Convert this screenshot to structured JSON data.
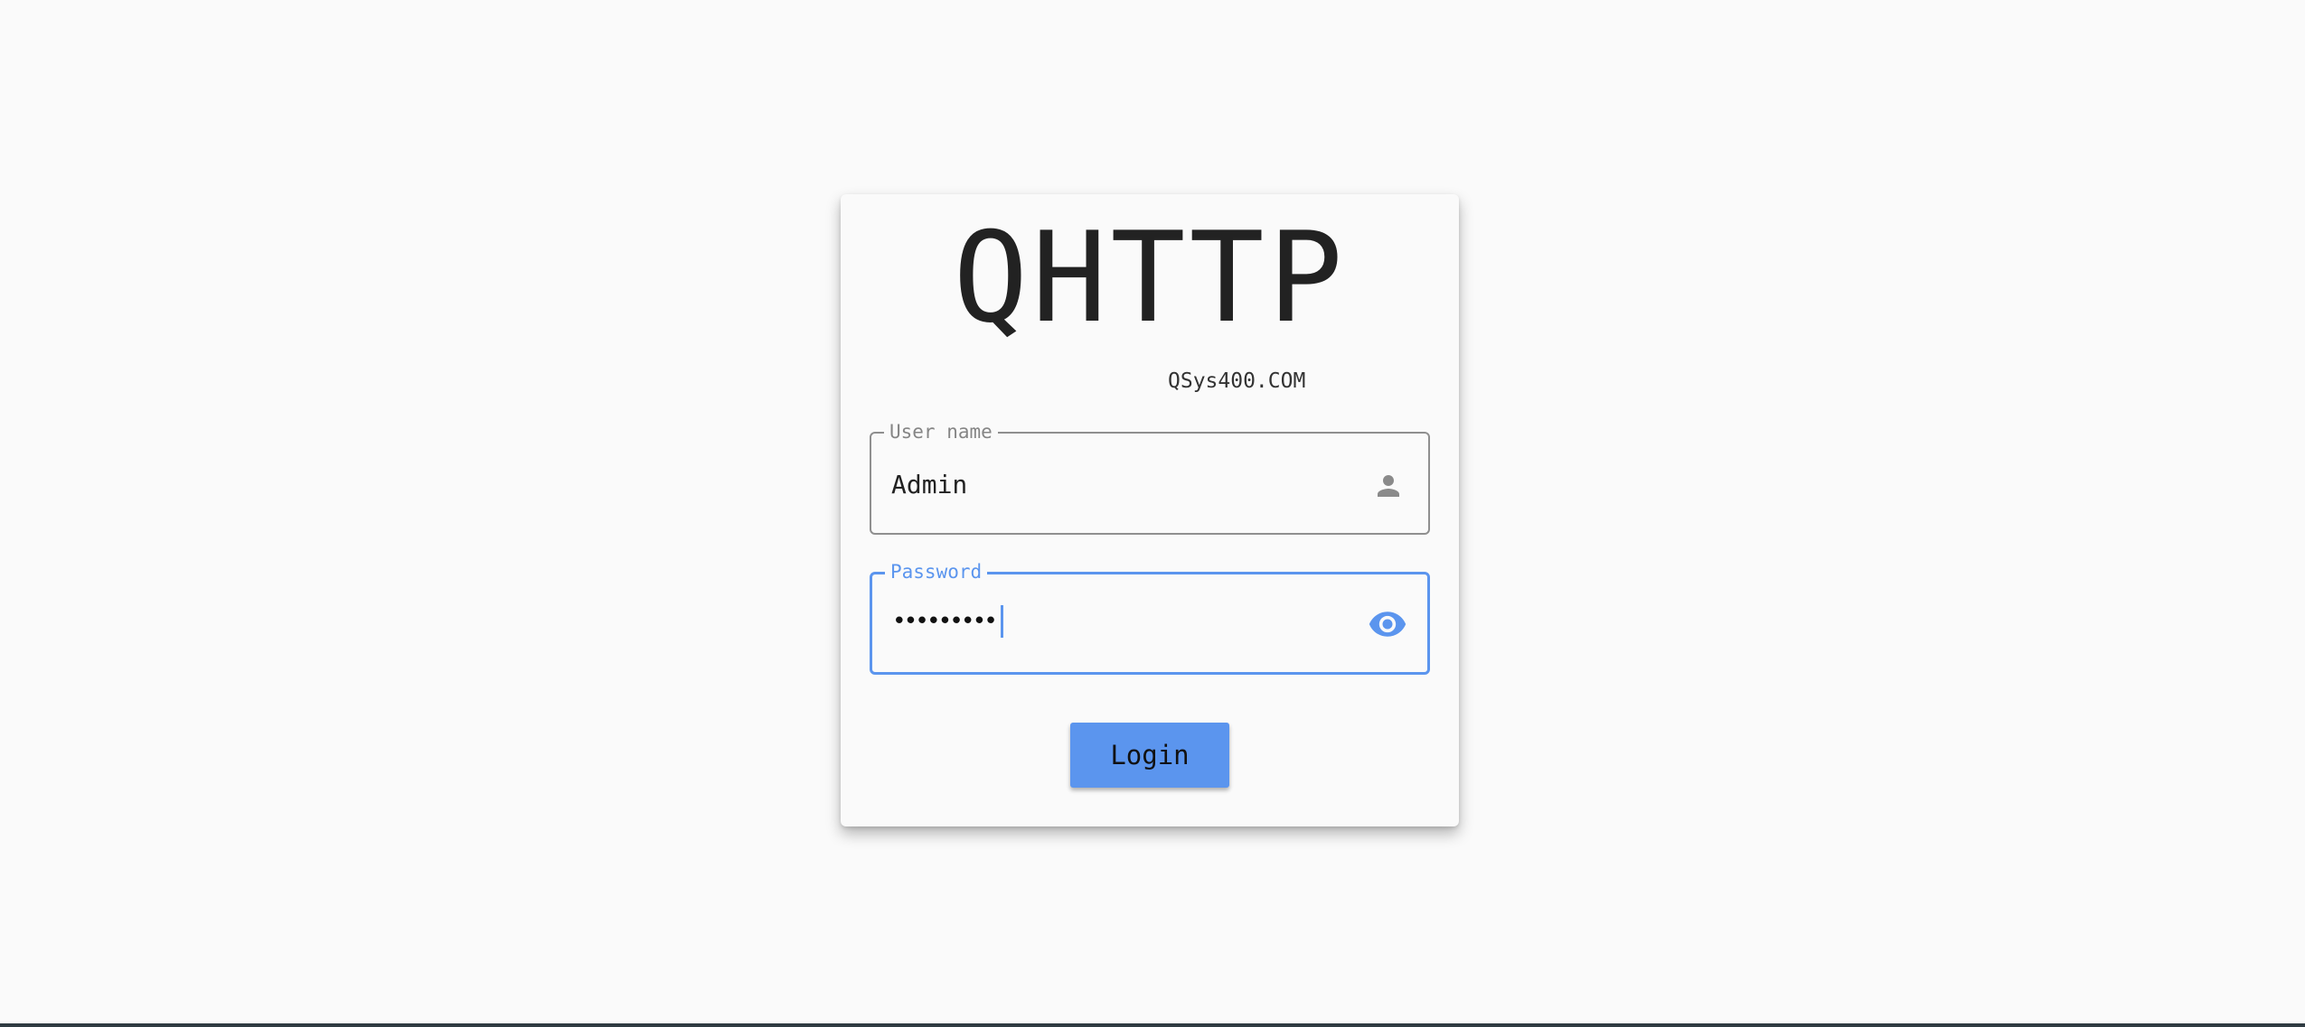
{
  "app": {
    "logo_text": "QHTTP",
    "subtitle": "QSys400.COM"
  },
  "form": {
    "username": {
      "label": "User name",
      "value": "Admin",
      "icon": "person-icon"
    },
    "password": {
      "label": "Password",
      "value": "•••••••••",
      "icon": "eye-icon",
      "state": "focused"
    },
    "login_label": "Login"
  },
  "colors": {
    "accent": "#5b95ee",
    "background": "#fafafa",
    "text": "#222222",
    "muted": "#858585"
  }
}
